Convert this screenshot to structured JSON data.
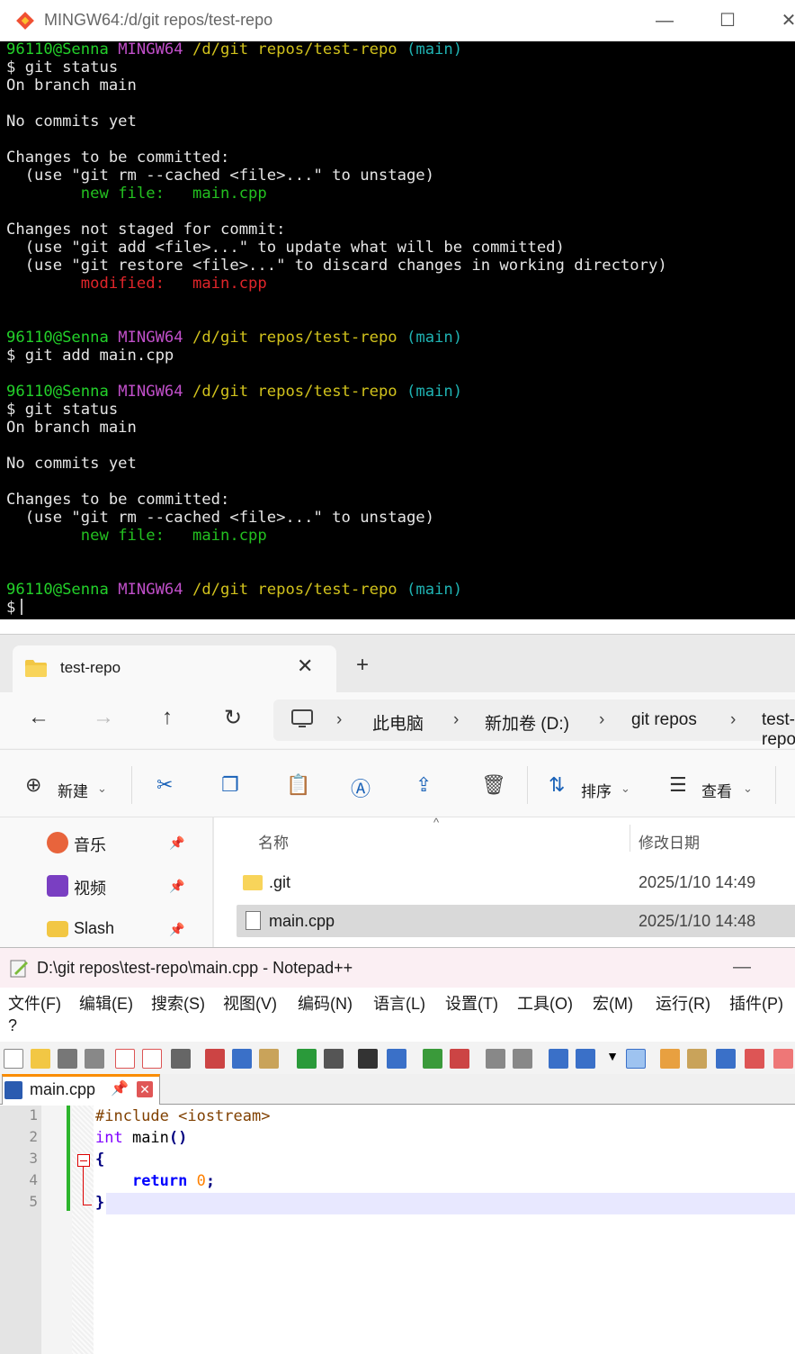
{
  "terminal": {
    "title": "MINGW64:/d/git repos/test-repo",
    "window_controls": {
      "minimize": "—",
      "maximize": "☐",
      "close": "✕"
    },
    "lines": [
      [
        {
          "t": "96110@Senna",
          "c": "c-user"
        },
        {
          "t": " "
        },
        {
          "t": "MINGW64",
          "c": "c-host"
        },
        {
          "t": " "
        },
        {
          "t": "/d/git repos/test-repo",
          "c": "c-path"
        },
        {
          "t": " "
        },
        {
          "t": "(main)",
          "c": "c-branch"
        }
      ],
      [
        {
          "t": "$ git status"
        }
      ],
      [
        {
          "t": "On branch main"
        }
      ],
      [],
      [
        {
          "t": "No commits yet"
        }
      ],
      [],
      [
        {
          "t": "Changes to be committed:"
        }
      ],
      [
        {
          "t": "  (use \"git rm --cached <file>...\" to unstage)"
        }
      ],
      [
        {
          "t": "        "
        },
        {
          "t": "new file:   main.cpp",
          "c": "c-green"
        }
      ],
      [],
      [
        {
          "t": "Changes not staged for commit:"
        }
      ],
      [
        {
          "t": "  (use \"git add <file>...\" to update what will be committed)"
        }
      ],
      [
        {
          "t": "  (use \"git restore <file>...\" to discard changes in working directory)"
        }
      ],
      [
        {
          "t": "        "
        },
        {
          "t": "modified:   main.cpp",
          "c": "c-red"
        }
      ],
      [],
      [],
      [
        {
          "t": "96110@Senna",
          "c": "c-user"
        },
        {
          "t": " "
        },
        {
          "t": "MINGW64",
          "c": "c-host"
        },
        {
          "t": " "
        },
        {
          "t": "/d/git repos/test-repo",
          "c": "c-path"
        },
        {
          "t": " "
        },
        {
          "t": "(main)",
          "c": "c-branch"
        }
      ],
      [
        {
          "t": "$ git add main.cpp"
        }
      ],
      [],
      [
        {
          "t": "96110@Senna",
          "c": "c-user"
        },
        {
          "t": " "
        },
        {
          "t": "MINGW64",
          "c": "c-host"
        },
        {
          "t": " "
        },
        {
          "t": "/d/git repos/test-repo",
          "c": "c-path"
        },
        {
          "t": " "
        },
        {
          "t": "(main)",
          "c": "c-branch"
        }
      ],
      [
        {
          "t": "$ git status"
        }
      ],
      [
        {
          "t": "On branch main"
        }
      ],
      [],
      [
        {
          "t": "No commits yet"
        }
      ],
      [],
      [
        {
          "t": "Changes to be committed:"
        }
      ],
      [
        {
          "t": "  (use \"git rm --cached <file>...\" to unstage)"
        }
      ],
      [
        {
          "t": "        "
        },
        {
          "t": "new file:   main.cpp",
          "c": "c-green"
        }
      ],
      [],
      [],
      [
        {
          "t": "96110@Senna",
          "c": "c-user"
        },
        {
          "t": " "
        },
        {
          "t": "MINGW64",
          "c": "c-host"
        },
        {
          "t": " "
        },
        {
          "t": "/d/git repos/test-repo",
          "c": "c-path"
        },
        {
          "t": " "
        },
        {
          "t": "(main)",
          "c": "c-branch"
        }
      ],
      [
        {
          "t": "$"
        }
      ]
    ]
  },
  "explorer": {
    "tab_label": "test-repo",
    "tab_close": "✕",
    "new_tab": "+",
    "nav": {
      "back": "←",
      "forward": "→",
      "up": "↑",
      "refresh": "↻"
    },
    "breadcrumb": [
      "此电脑",
      "新加卷 (D:)",
      "git repos",
      "test-repo"
    ],
    "breadcrumb_sep": "›",
    "commands": {
      "new": "新建",
      "sort": "排序",
      "view": "查看"
    },
    "sidebar": [
      {
        "label": "音乐",
        "icon": "music-icon",
        "color": "#e8643c"
      },
      {
        "label": "视频",
        "icon": "video-icon",
        "color": "#7a3fc2"
      },
      {
        "label": "Slash",
        "icon": "folder-icon",
        "color": "#f2c744"
      }
    ],
    "columns": {
      "name": "名称",
      "modified": "修改日期"
    },
    "files": [
      {
        "name": ".git",
        "modified": "2025/1/10 14:49",
        "type": "folder"
      },
      {
        "name": "main.cpp",
        "modified": "2025/1/10 14:48",
        "type": "file",
        "selected": true
      }
    ]
  },
  "notepad": {
    "title": "D:\\git repos\\test-repo\\main.cpp - Notepad++",
    "minimize": "—",
    "menu": [
      "文件(F)",
      "编辑(E)",
      "搜索(S)",
      "视图(V)",
      "编码(N)",
      "语言(L)",
      "设置(T)",
      "工具(O)",
      "宏(M)",
      "运行(R)",
      "插件(P)",
      "?"
    ],
    "tab": {
      "name": "main.cpp",
      "pin": "📌",
      "close": "✕"
    },
    "line_numbers": [
      "1",
      "2",
      "3",
      "4",
      "5"
    ],
    "code": [
      [
        {
          "t": "#include <iostream>",
          "c": "k-pre"
        }
      ],
      [
        {
          "t": "int",
          "c": "k-type"
        },
        {
          "t": " main",
          "c": "k-plain"
        },
        {
          "t": "()",
          "c": "k-op"
        }
      ],
      [
        {
          "t": "{",
          "c": "k-op"
        }
      ],
      [
        {
          "t": "    "
        },
        {
          "t": "return",
          "c": "k-kw"
        },
        {
          "t": " "
        },
        {
          "t": "0",
          "c": "k-num"
        },
        {
          "t": ";",
          "c": "k-op"
        }
      ],
      [
        {
          "t": "}",
          "c": "k-op"
        }
      ]
    ]
  }
}
